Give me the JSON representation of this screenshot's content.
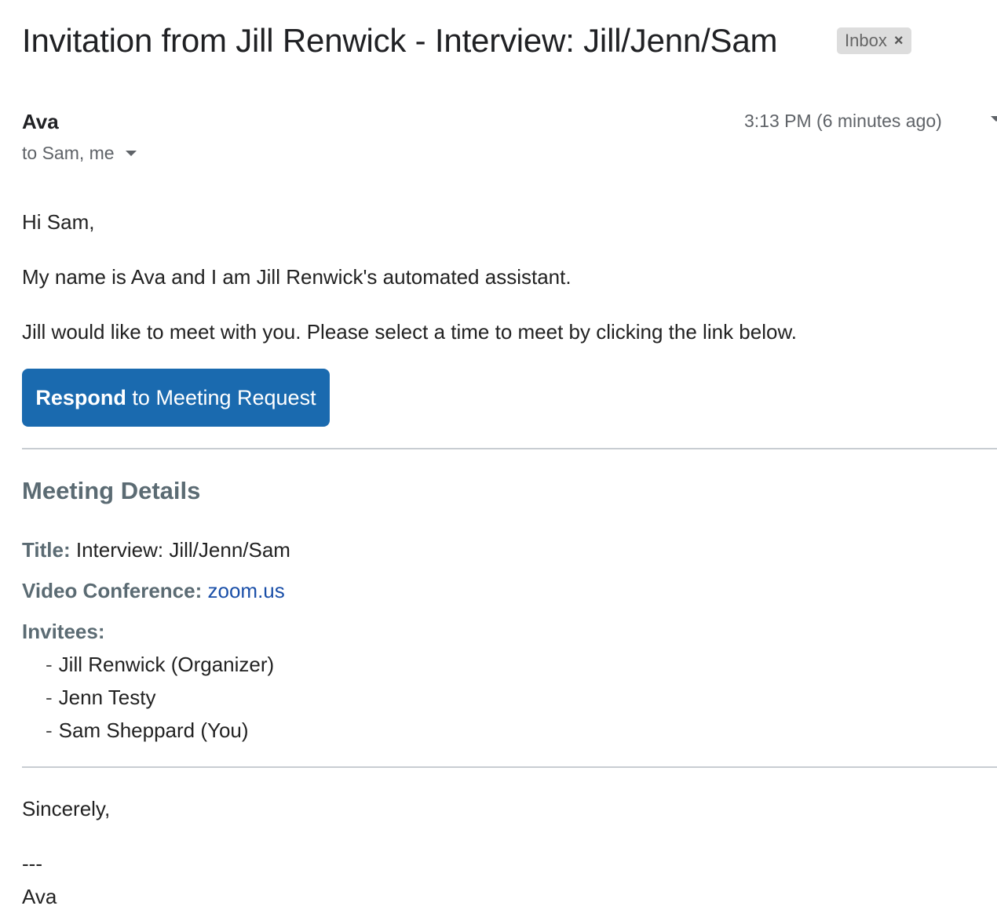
{
  "email": {
    "subject": "Invitation from Jill Renwick - Interview: Jill/Jenn/Sam",
    "label": "Inbox",
    "label_close": "×",
    "sender": "Ava",
    "timestamp": "3:13 PM (6 minutes ago)",
    "recipients": "to Sam, me",
    "body": {
      "greeting": "Hi Sam,",
      "intro": "My name is Ava and I am Jill Renwick's automated assistant.",
      "request": "Jill would like to meet with you. Please select a time to meet by clicking the link below.",
      "button_strong": "Respond",
      "button_rest": " to Meeting Request"
    },
    "details": {
      "heading": "Meeting Details",
      "title_label": "Title:",
      "title_value": " Interview: Jill/Jenn/Sam",
      "video_label": "Video Conference:",
      "video_value": "zoom.us",
      "invitees_label": "Invitees:",
      "invitees": [
        "Jill Renwick (Organizer)",
        "Jenn Testy",
        "Sam Sheppard (You)"
      ]
    },
    "signoff": {
      "closing": "Sincerely,",
      "separator": "---",
      "name": "Ava"
    }
  }
}
